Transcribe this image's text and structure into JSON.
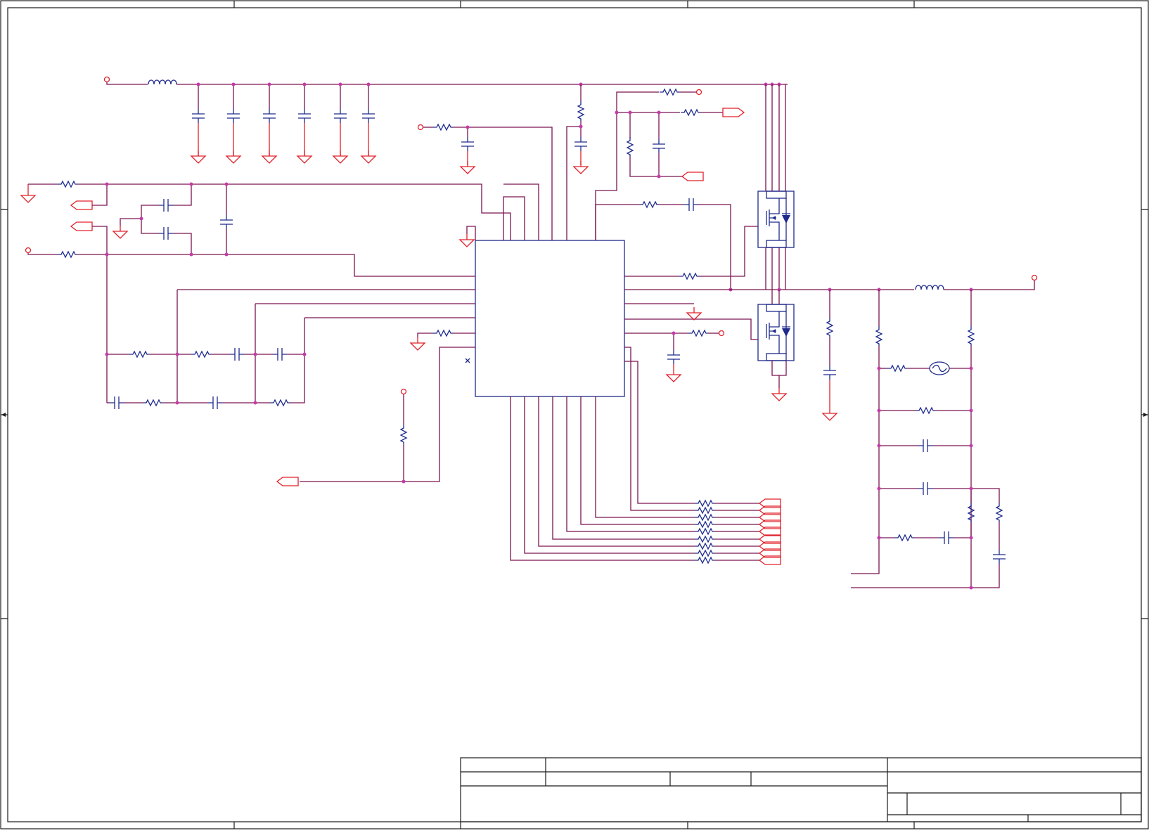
{
  "colors": {
    "wire": "#7a1450",
    "net": "#1e2a8c",
    "power": "#e0202a",
    "component": "#1e2a8c",
    "junction": "#c63aa8",
    "frame": "#1a1a1a"
  },
  "title_block": {
    "cells": []
  }
}
